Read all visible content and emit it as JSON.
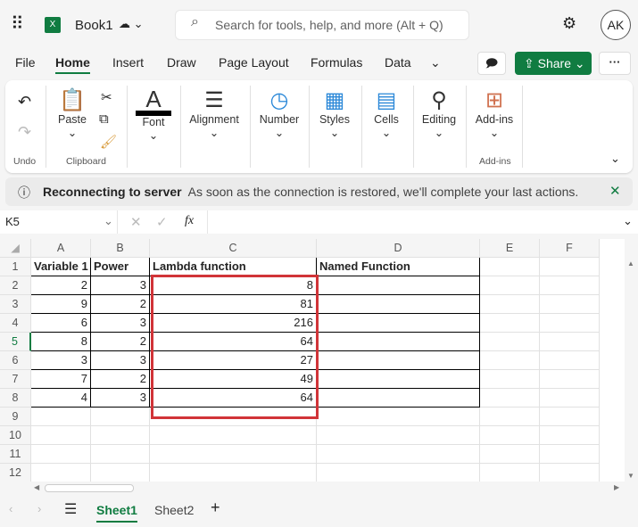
{
  "app": {
    "name": "Book1",
    "search_placeholder": "Search for tools, help, and more (Alt + Q)",
    "user_initials": "AK"
  },
  "menu": [
    "File",
    "Home",
    "Insert",
    "Draw",
    "Page Layout",
    "Formulas",
    "Data"
  ],
  "share_label": "Share",
  "ribbon": {
    "groups": [
      {
        "label": "Paste"
      },
      {
        "label": "Font"
      },
      {
        "label": "Alignment"
      },
      {
        "label": "Number"
      },
      {
        "label": "Styles"
      },
      {
        "label": "Cells"
      },
      {
        "label": "Editing"
      },
      {
        "label": "Add-ins"
      }
    ],
    "group_labels": {
      "undo": "Undo",
      "clipboard": "Clipboard",
      "addins": "Add-ins"
    }
  },
  "banner": {
    "title": "Reconnecting to server",
    "message": "As soon as the connection is restored, we'll complete your last actions."
  },
  "formula_bar": {
    "name_box": "K5",
    "fx": "fx",
    "value": ""
  },
  "columns": [
    "A",
    "B",
    "C",
    "D",
    "E",
    "F"
  ],
  "rows": [
    "1",
    "2",
    "3",
    "4",
    "5",
    "6",
    "7",
    "8",
    "9",
    "10",
    "11",
    "12"
  ],
  "table": {
    "headers": [
      "Variable 1",
      "Power",
      "Lambda function",
      "Named Function"
    ],
    "data": [
      [
        "2",
        "3",
        "8",
        ""
      ],
      [
        "9",
        "2",
        "81",
        ""
      ],
      [
        "6",
        "3",
        "216",
        ""
      ],
      [
        "8",
        "2",
        "64",
        ""
      ],
      [
        "3",
        "3",
        "27",
        ""
      ],
      [
        "7",
        "2",
        "49",
        ""
      ],
      [
        "4",
        "3",
        "64",
        ""
      ]
    ]
  },
  "sheets": [
    "Sheet1",
    "Sheet2"
  ],
  "colors": {
    "accent": "#107c41",
    "highlight": "#d13438"
  }
}
